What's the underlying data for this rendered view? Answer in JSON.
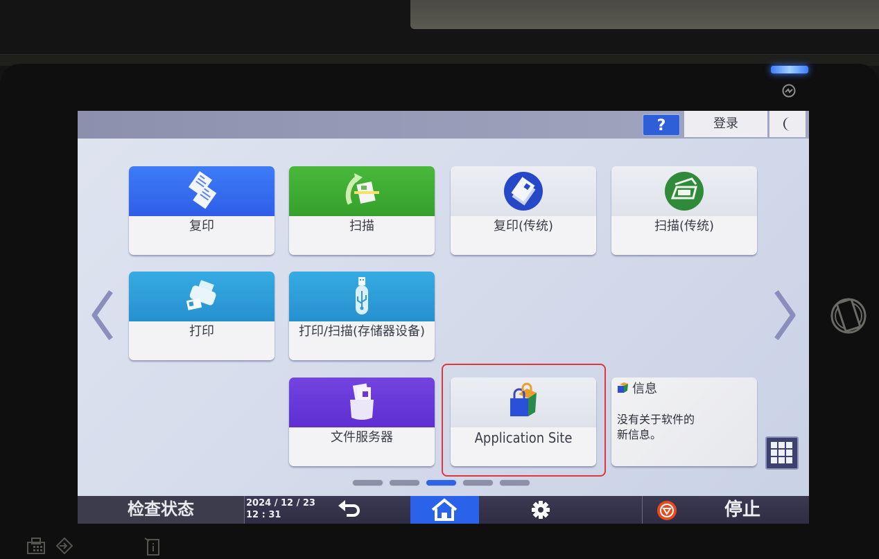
{
  "topbar": {
    "help_label": "?",
    "login_label": "登录",
    "sleep_icon": "moon-icon"
  },
  "tiles": [
    {
      "label": "复印",
      "icon": "copy-icon",
      "color": "#2f62f0"
    },
    {
      "label": "扫描",
      "icon": "scan-icon",
      "color": "#3aa52e"
    },
    {
      "label": "复印(传统)",
      "icon": "classic-copy-icon",
      "color": "#2448c8"
    },
    {
      "label": "扫描(传统)",
      "icon": "classic-scan-icon",
      "color": "#2f8a3a"
    },
    {
      "label": "打印",
      "icon": "printer-icon",
      "color": "#2a9ad6"
    },
    {
      "label": "打印/扫描(存储器设备)",
      "icon": "usb-icon",
      "color": "#2a9ad6"
    },
    {
      "label": "文件服务器",
      "icon": "document-server-icon",
      "color": "#6b35d8"
    },
    {
      "label": "Application Site",
      "icon": "shopping-bag-icon",
      "color": "#e8e9ef"
    }
  ],
  "info_widget": {
    "title": "信息",
    "message": "没有关于软件的新信息。",
    "message_line1": "没有关于软件的",
    "message_line2": "新信息。"
  },
  "pagination": {
    "total_pages": 5,
    "current_page": 3
  },
  "bottombar": {
    "status_label": "检查状态",
    "date": "2024 / 12 / 23",
    "time": "12 : 31",
    "stop_label": "停止"
  },
  "colors": {
    "accent": "#2a63ea",
    "highlight_box": "#e0353a",
    "stop": "#e84a1e"
  }
}
